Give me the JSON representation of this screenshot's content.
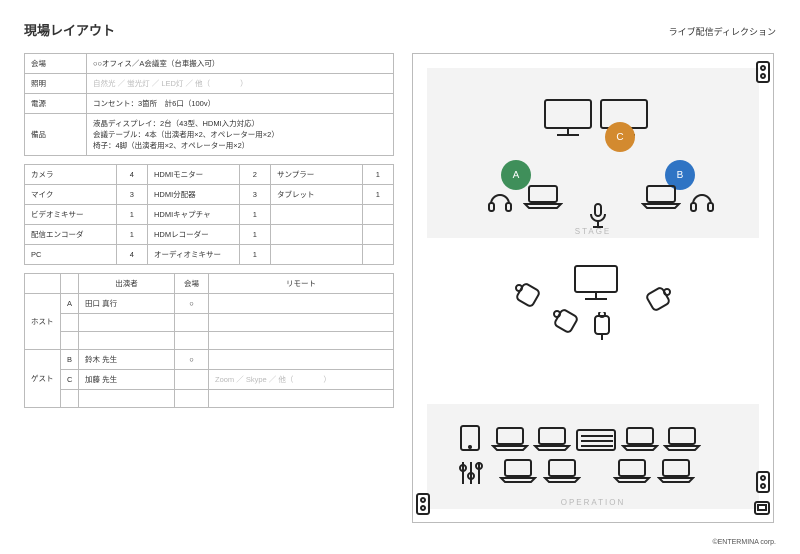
{
  "header": {
    "title": "現場レイアウト",
    "subtitle": "ライブ配信ディレクション"
  },
  "venue": {
    "rows": [
      {
        "label": "会場",
        "value": "○○オフィス／A会議室（台車搬入可）"
      },
      {
        "label": "照明",
        "value": "自然光 ／ 蛍光灯 ／ LED灯 ／ 他（　　　　）",
        "muted": true
      },
      {
        "label": "電源",
        "value": "コンセント：3箇所　計6口（100v）"
      },
      {
        "label": "備品",
        "value": "液晶ディスプレイ：2台（43型、HDMI入力対応）\n会議テーブル：4本（出演者用×2、オペレーター用×2）\n椅子：4脚（出演者用×2、オペレーター用×2）"
      }
    ]
  },
  "equipment": [
    {
      "a": "カメラ",
      "an": "4",
      "b": "HDMIモニター",
      "bn": "2",
      "c": "サンプラー",
      "cn": "1"
    },
    {
      "a": "マイク",
      "an": "3",
      "b": "HDMI分配器",
      "bn": "3",
      "c": "タブレット",
      "cn": "1"
    },
    {
      "a": "ビデオミキサー",
      "an": "1",
      "b": "HDMIキャプチャ",
      "bn": "1",
      "c": "",
      "cn": ""
    },
    {
      "a": "配信エンコーダ",
      "an": "1",
      "b": "HDMレコーダー",
      "bn": "1",
      "c": "",
      "cn": ""
    },
    {
      "a": "PC",
      "an": "4",
      "b": "オーディオミキサー",
      "bn": "1",
      "c": "",
      "cn": ""
    }
  ],
  "participants": {
    "headers": {
      "performer": "出演者",
      "venue": "会場",
      "remote": "リモート"
    },
    "remote_hint": "Zoom ／ Skype ／ 他（　　　　）",
    "groups": [
      {
        "role": "ホスト",
        "rows": [
          {
            "idx": "A",
            "name": "田口 真行",
            "venue": "○",
            "remote": ""
          },
          {
            "idx": "",
            "name": "",
            "venue": "",
            "remote": ""
          },
          {
            "idx": "",
            "name": "",
            "venue": "",
            "remote": ""
          }
        ]
      },
      {
        "role": "ゲスト",
        "rows": [
          {
            "idx": "B",
            "name": "鈴木 先生",
            "venue": "○",
            "remote": ""
          },
          {
            "idx": "C",
            "name": "加藤 先生",
            "venue": "",
            "remote": "HINT"
          },
          {
            "idx": "",
            "name": "",
            "venue": "",
            "remote": ""
          }
        ]
      }
    ]
  },
  "diagram": {
    "stage_label": "STAGE",
    "operation_label": "OPERATION",
    "badges": {
      "a": "A",
      "b": "B",
      "c": "C"
    }
  },
  "footer": "©ENTERMINA corp."
}
